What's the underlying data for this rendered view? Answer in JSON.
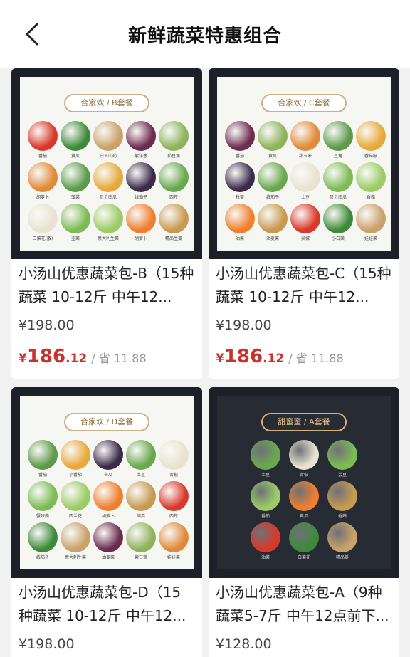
{
  "header": {
    "title": "新鲜蔬菜特惠组合"
  },
  "products": [
    {
      "banner": "合家欢 / B套餐",
      "name": "小汤山优惠蔬菜包-B（15种蔬菜 10-12斤 中午12...",
      "original_price": "¥198.00",
      "sale_symbol": "¥",
      "sale_int": "186",
      "sale_dec": ".12",
      "saving": "/ 省 11.88",
      "veg_labels": [
        "番茄",
        "黄瓜",
        "白玉山药",
        "紫洋葱",
        "茄豆角",
        "胡萝卜",
        "菠菜",
        "贝贝南瓜",
        "线茄子",
        "西芹",
        "白菜花(散)",
        "韭菜",
        "意大利生菜",
        "胡萝卜",
        "精品生姜"
      ],
      "dark": false
    },
    {
      "banner": "合家欢 / C套餐",
      "name": "小汤山优惠蔬菜包-C（15种蔬菜 10-12斤 中午12...",
      "original_price": "¥198.00",
      "sale_symbol": "¥",
      "sale_int": "186",
      "sale_dec": ".12",
      "saving": "/ 省 11.88",
      "veg_labels": [
        "番茄",
        "黄瓜",
        "甜玉米",
        "豆角",
        "香菇椒",
        "秋葵",
        "线茄子",
        "土豆",
        "贝贝南瓜",
        "香菇",
        "油菜",
        "油麦菜",
        "尖椒",
        "小白菜",
        "娃娃菜"
      ],
      "dark": false
    },
    {
      "banner": "合家欢 / D套餐",
      "name": "小汤山优惠蔬菜包-D（15种蔬菜 10-12斤 中午12...",
      "original_price": "¥198.00",
      "sale_symbol": "",
      "sale_int": "",
      "sale_dec": "",
      "saving": "",
      "veg_labels": [
        "番茄",
        "小番茄",
        "苦瓜",
        "土豆",
        "青椒",
        "蟹味菇",
        "西兰花",
        "胡萝卜",
        "茼蒿",
        "西芹",
        "线茄子",
        "意大利生菜",
        "油麦菜",
        "紫甘蓝",
        "娃娃菜"
      ],
      "dark": false
    },
    {
      "banner": "甜蜜蜜 / A套餐",
      "name": "小汤山优惠蔬菜包-A（9种蔬菜5-7斤 中午12点前下...",
      "original_price": "¥128.00",
      "sale_symbol": "",
      "sale_int": "",
      "sale_dec": "",
      "saving": "",
      "veg_labels": [
        "土豆",
        "青椒",
        "芸豆",
        "番茄",
        "黄瓜",
        "香菇",
        "油菜",
        "白菜花",
        "精品姜"
      ],
      "dark": true
    }
  ]
}
